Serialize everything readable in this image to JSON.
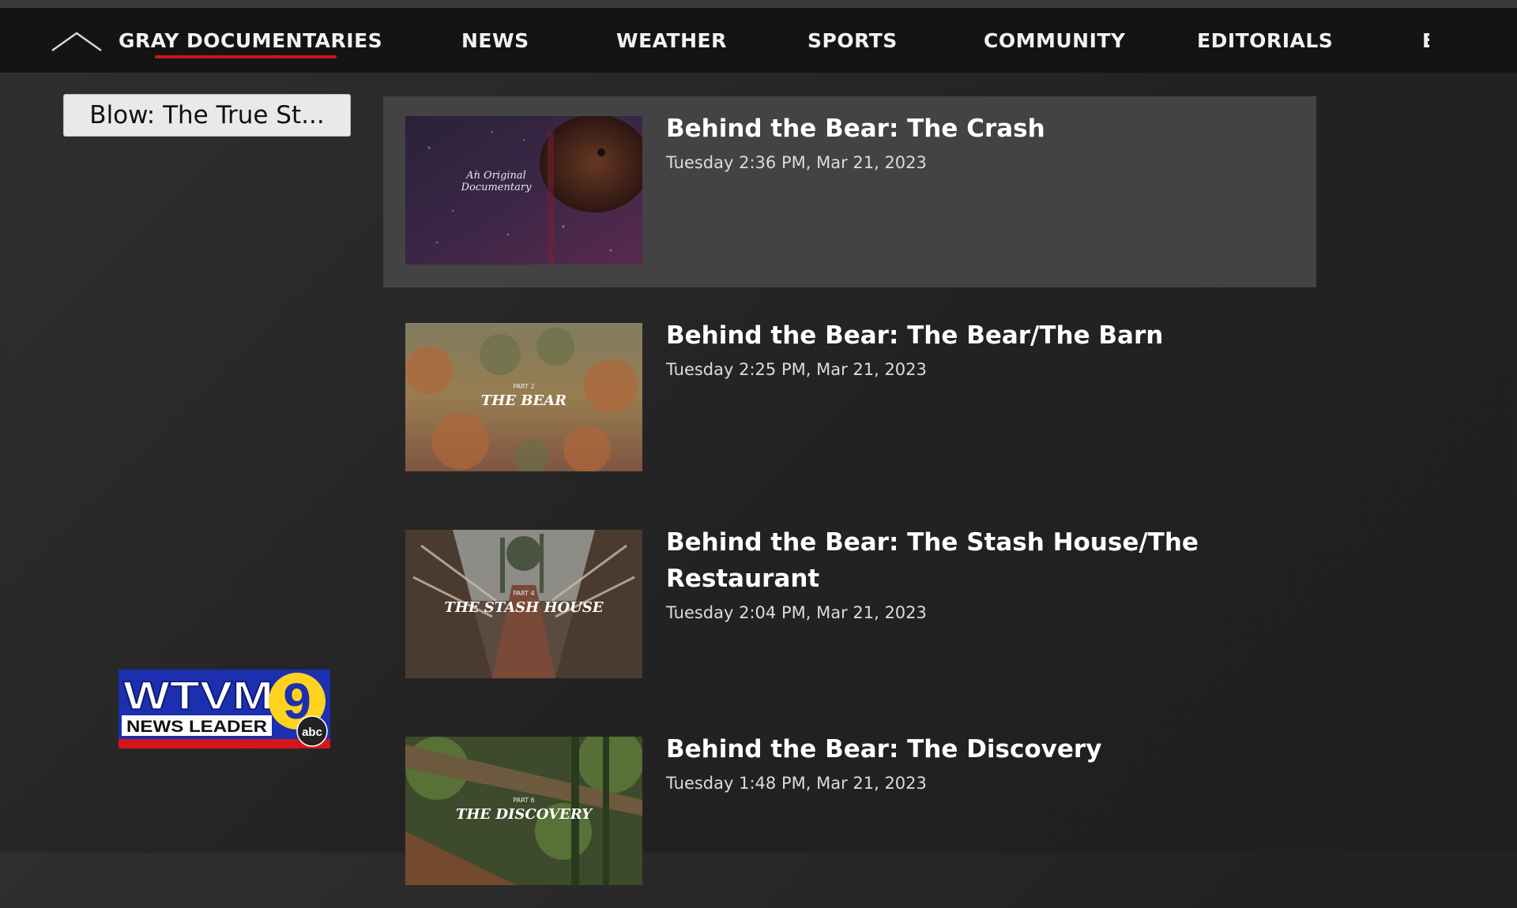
{
  "nav": {
    "items": [
      "GRAY DOCUMENTARIES",
      "NEWS",
      "WEATHER",
      "SPORTS",
      "COMMUNITY",
      "EDITORIALS",
      "E"
    ],
    "active_index": 0,
    "accent_color": "#d0141d"
  },
  "show_selector": {
    "label": "Blow: The True St..."
  },
  "episodes": [
    {
      "title": "Behind the Bear: The Crash",
      "date": "Tuesday 2:36 PM, Mar 21, 2023",
      "thumb_text": "An Original Documentary",
      "selected": true
    },
    {
      "title": "Behind the Bear: The Bear/The Barn",
      "date": "Tuesday 2:25 PM, Mar 21, 2023",
      "thumb_part": "PART 2",
      "thumb_text": "THE BEAR"
    },
    {
      "title": "Behind the Bear: The Stash House/The Restaurant",
      "date": "Tuesday 2:04 PM, Mar 21, 2023",
      "thumb_part": "PART 4",
      "thumb_text": "THE STASH HOUSE"
    },
    {
      "title": "Behind the Bear: The Discovery",
      "date": "Tuesday 1:48 PM, Mar 21, 2023",
      "thumb_part": "PART 6",
      "thumb_text": "THE DISCOVERY"
    }
  ],
  "logo": {
    "name": "WTVM 9 News Leader abc",
    "text_main": "WTVM",
    "text_sub": "NEWS LEADER",
    "number": "9",
    "network": "abc",
    "colors": {
      "blue": "#1b2fb0",
      "yellow": "#ffd21f",
      "red": "#d3151c"
    }
  }
}
